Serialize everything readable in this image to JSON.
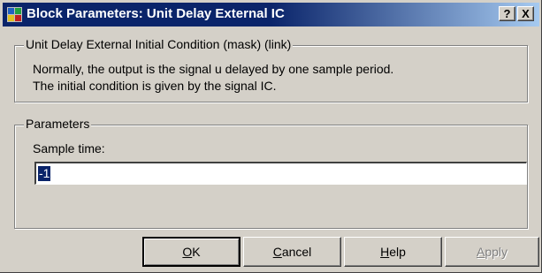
{
  "window": {
    "title": "Block Parameters: Unit Delay External IC",
    "help_button": "?",
    "close_button": "X"
  },
  "description_group": {
    "legend": "Unit Delay External Initial Condition (mask) (link)",
    "line1": "Normally, the output is the signal u delayed by one sample period.",
    "line2": "The initial condition is given by the signal IC."
  },
  "parameters_group": {
    "legend": "Parameters",
    "sample_time_label": "Sample time:",
    "sample_time_value": "-1"
  },
  "buttons": {
    "ok": {
      "mnemonic": "O",
      "rest": "K"
    },
    "cancel": {
      "mnemonic": "C",
      "rest": "ancel"
    },
    "help": {
      "mnemonic": "H",
      "rest": "elp"
    },
    "apply": {
      "mnemonic": "A",
      "rest": "pply",
      "enabled": false
    }
  }
}
